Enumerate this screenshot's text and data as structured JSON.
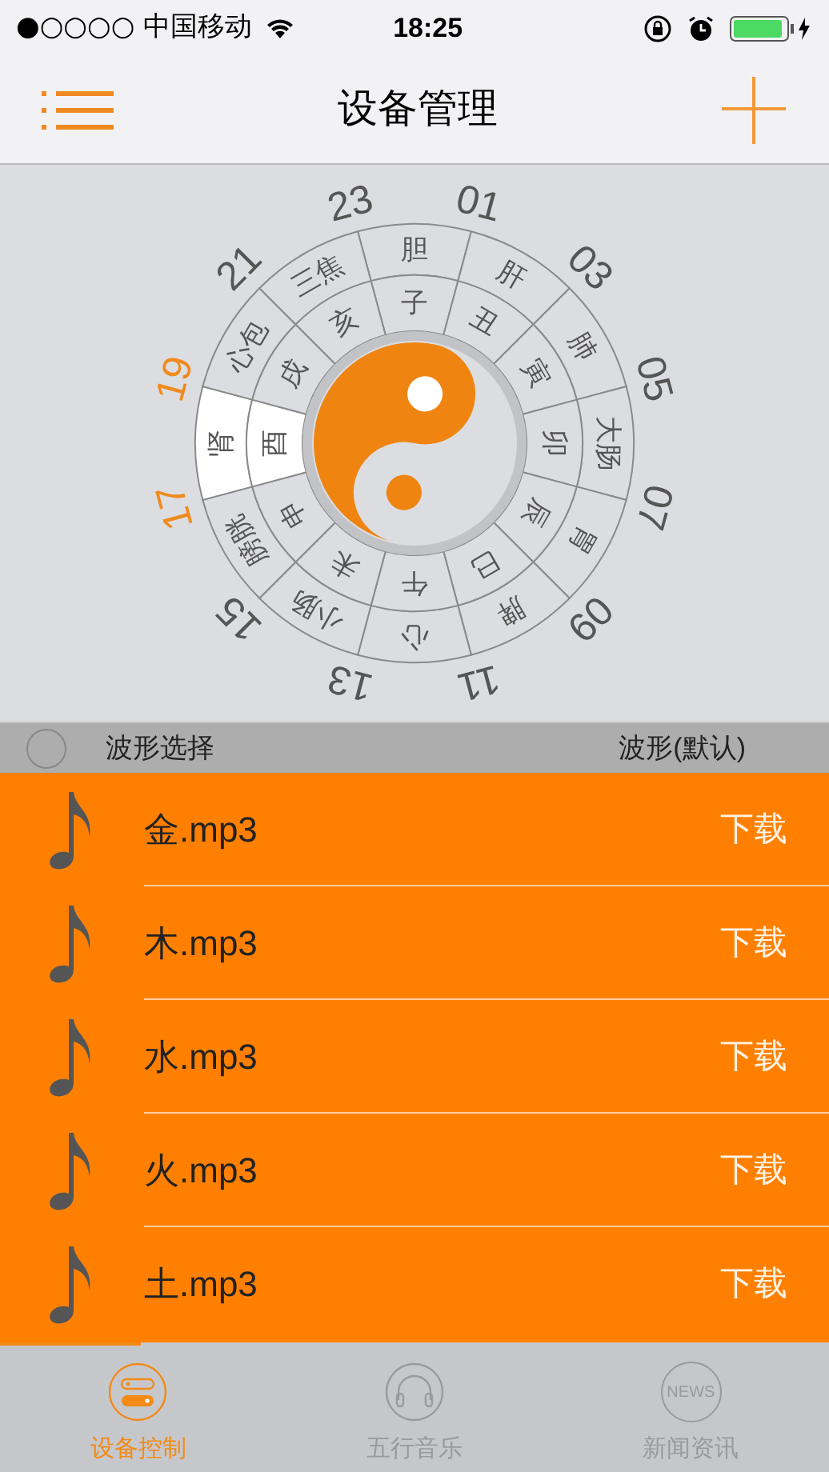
{
  "status_bar": {
    "carrier": "●○○○○ 中国移动",
    "time": "18:25"
  },
  "nav": {
    "title": "设备管理"
  },
  "wheel": {
    "sectors": [
      {
        "branch": "子",
        "organ": "胆",
        "selected": false
      },
      {
        "branch": "丑",
        "organ": "肝",
        "selected": false
      },
      {
        "branch": "寅",
        "organ": "肺",
        "selected": false
      },
      {
        "branch": "卯",
        "organ": "大肠",
        "selected": false
      },
      {
        "branch": "辰",
        "organ": "胃",
        "selected": false
      },
      {
        "branch": "巳",
        "organ": "脾",
        "selected": false
      },
      {
        "branch": "午",
        "organ": "心",
        "selected": false
      },
      {
        "branch": "未",
        "organ": "小肠",
        "selected": false
      },
      {
        "branch": "申",
        "organ": "膀胱",
        "selected": false
      },
      {
        "branch": "酉",
        "organ": "肾",
        "selected": true
      },
      {
        "branch": "戌",
        "organ": "心包",
        "selected": false
      },
      {
        "branch": "亥",
        "organ": "三焦",
        "selected": false
      }
    ],
    "hours": [
      {
        "label": "01",
        "highlighted": false
      },
      {
        "label": "03",
        "highlighted": false
      },
      {
        "label": "05",
        "highlighted": false
      },
      {
        "label": "07",
        "highlighted": false
      },
      {
        "label": "09",
        "highlighted": false
      },
      {
        "label": "11",
        "highlighted": false
      },
      {
        "label": "13",
        "highlighted": false
      },
      {
        "label": "15",
        "highlighted": false
      },
      {
        "label": "17",
        "highlighted": true
      },
      {
        "label": "19",
        "highlighted": true
      },
      {
        "label": "21",
        "highlighted": false
      },
      {
        "label": "23",
        "highlighted": false
      }
    ]
  },
  "wave_row": {
    "label": "波形选择",
    "value": "波形(默认)"
  },
  "songs": [
    {
      "name": "金.mp3",
      "action": "下载"
    },
    {
      "name": "木.mp3",
      "action": "下载"
    },
    {
      "name": "水.mp3",
      "action": "下载"
    },
    {
      "name": "火.mp3",
      "action": "下载"
    },
    {
      "name": "土.mp3",
      "action": "下载"
    }
  ],
  "tabs": [
    {
      "label": "设备控制",
      "kind": "device",
      "selected": true
    },
    {
      "label": "五行音乐",
      "kind": "music",
      "selected": false
    },
    {
      "label": "新闻资讯",
      "kind": "news",
      "selected": false,
      "icon_text": "NEWS"
    }
  ]
}
